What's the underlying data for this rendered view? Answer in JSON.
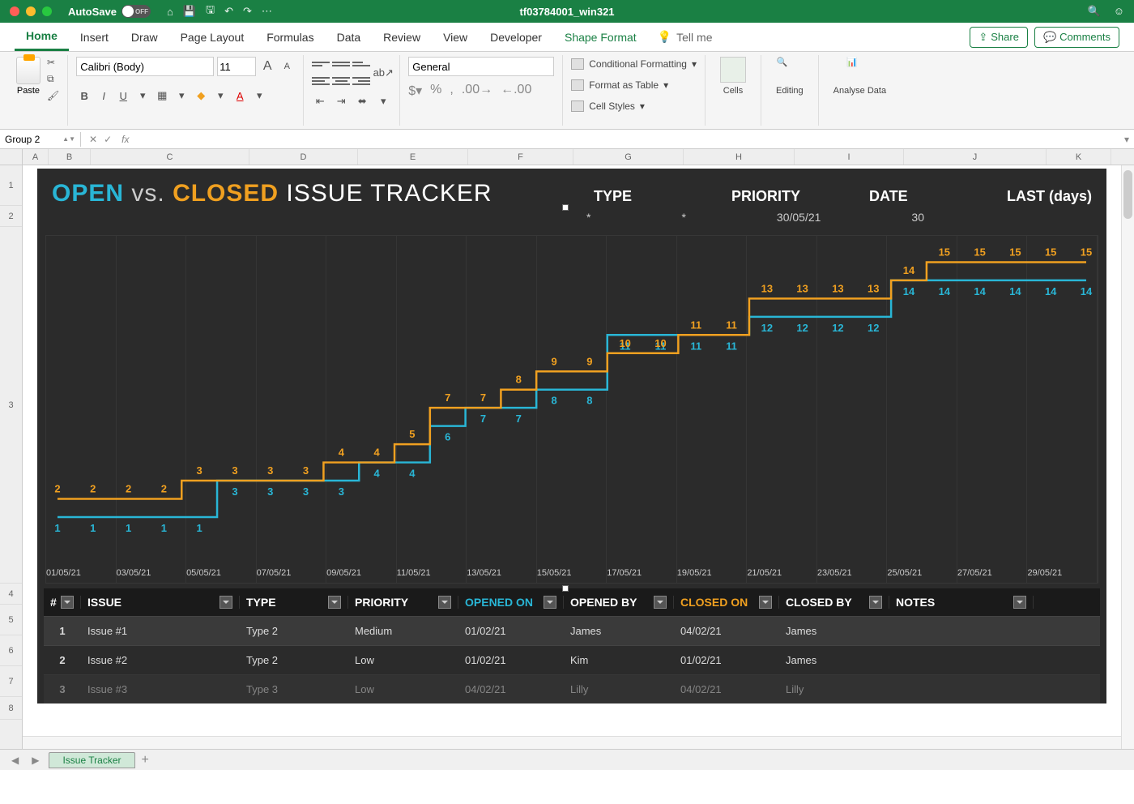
{
  "titlebar": {
    "autosave": "AutoSave",
    "toggle": "OFF",
    "filename": "tf03784001_win321"
  },
  "tabs": {
    "home": "Home",
    "insert": "Insert",
    "draw": "Draw",
    "layout": "Page Layout",
    "formulas": "Formulas",
    "data": "Data",
    "review": "Review",
    "view": "View",
    "developer": "Developer",
    "shape": "Shape Format",
    "tellme": "Tell me",
    "share": "Share",
    "comments": "Comments"
  },
  "ribbon": {
    "paste": "Paste",
    "font": "Calibri (Body)",
    "size": "11",
    "number": "General",
    "cond": "Conditional Formatting",
    "fat": "Format as Table",
    "cs": "Cell Styles",
    "cells": "Cells",
    "editing": "Editing",
    "analyse": "Analyse Data"
  },
  "namebox": "Group 2",
  "cols": {
    "A": "A",
    "B": "B",
    "C": "C",
    "D": "D",
    "E": "E",
    "F": "F",
    "G": "G",
    "H": "H",
    "I": "I",
    "J": "J",
    "K": "K"
  },
  "rows": {
    "r1": "1",
    "r2": "2",
    "r3": "3",
    "r4": "4",
    "r5": "5",
    "r6": "6",
    "r7": "7",
    "r8": "8"
  },
  "header": {
    "open": "OPEN",
    "vs": "vs.",
    "closed": "CLOSED",
    "tracker": "ISSUE TRACKER",
    "type": "TYPE",
    "priority": "PRIORITY",
    "date": "DATE",
    "last": "LAST (days)",
    "type_v": "*",
    "priority_v": "*",
    "date_v": "30/05/21",
    "last_v": "30"
  },
  "chart_data": {
    "type": "line",
    "x": [
      "01/05/21",
      "02/05/21",
      "03/05/21",
      "04/05/21",
      "05/05/21",
      "06/05/21",
      "07/05/21",
      "08/05/21",
      "09/05/21",
      "10/05/21",
      "11/05/21",
      "12/05/21",
      "13/05/21",
      "14/05/21",
      "15/05/21",
      "16/05/21",
      "17/05/21",
      "18/05/21",
      "19/05/21",
      "20/05/21",
      "21/05/21",
      "22/05/21",
      "23/05/21",
      "24/05/21",
      "25/05/21",
      "26/05/21",
      "27/05/21",
      "28/05/21",
      "29/05/21",
      "30/05/21"
    ],
    "x_ticks": [
      "01/05/21",
      "03/05/21",
      "05/05/21",
      "07/05/21",
      "09/05/21",
      "11/05/21",
      "13/05/21",
      "15/05/21",
      "17/05/21",
      "19/05/21",
      "21/05/21",
      "23/05/21",
      "25/05/21",
      "27/05/21",
      "29/05/21"
    ],
    "series": [
      {
        "name": "Open",
        "color": "#29b6d6",
        "values": [
          1,
          1,
          1,
          1,
          1,
          3,
          3,
          3,
          3,
          4,
          4,
          6,
          7,
          7,
          8,
          8,
          11,
          11,
          11,
          11,
          12,
          12,
          12,
          12,
          14,
          14,
          14,
          14,
          14,
          14
        ]
      },
      {
        "name": "Closed",
        "color": "#f0a020",
        "values": [
          2,
          2,
          2,
          2,
          3,
          3,
          3,
          3,
          4,
          4,
          5,
          7,
          7,
          8,
          9,
          9,
          10,
          10,
          11,
          11,
          13,
          13,
          13,
          13,
          14,
          15,
          15,
          15,
          15,
          15
        ]
      }
    ],
    "ylim": [
      0,
      16
    ]
  },
  "table": {
    "head": {
      "num": "#",
      "issue": "ISSUE",
      "type": "TYPE",
      "priority": "PRIORITY",
      "opened": "OPENED ON",
      "openedby": "OPENED BY",
      "closed": "CLOSED ON",
      "closedby": "CLOSED BY",
      "notes": "NOTES"
    },
    "rows": [
      {
        "n": "1",
        "issue": "Issue #1",
        "type": "Type 2",
        "pri": "Medium",
        "op": "01/02/21",
        "opby": "James",
        "cl": "04/02/21",
        "clby": "James"
      },
      {
        "n": "2",
        "issue": "Issue #2",
        "type": "Type 2",
        "pri": "Low",
        "op": "01/02/21",
        "opby": "Kim",
        "cl": "01/02/21",
        "clby": "James"
      },
      {
        "n": "3",
        "issue": "Issue #3",
        "type": "Type 3",
        "pri": "Low",
        "op": "04/02/21",
        "opby": "Lilly",
        "cl": "04/02/21",
        "clby": "Lilly"
      }
    ]
  },
  "sheettab": "Issue Tracker"
}
